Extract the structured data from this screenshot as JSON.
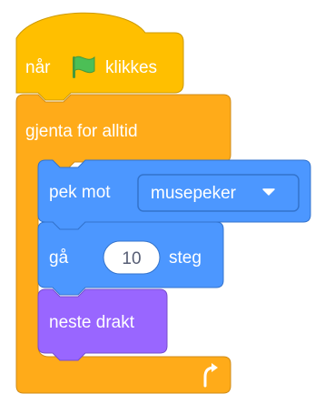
{
  "palette": {
    "events": "#ffbf00",
    "events_border": "#cc9900",
    "control": "#ffab19",
    "control_border": "#cf8b17",
    "motion": "#4c97ff",
    "motion_border": "#3373cc",
    "looks": "#9966ff",
    "looks_border": "#774dcb",
    "flag": "#4cbf56",
    "flag_dark": "#45993d"
  },
  "blocks": {
    "when_flag": {
      "prefix": "når",
      "flag_icon": "green-flag-icon",
      "suffix": "klikkes"
    },
    "forever": {
      "label": "gjenta for alltid",
      "loop_icon": "loop-arrow-icon"
    },
    "point_towards": {
      "label": "pek mot",
      "dropdown_value": "musepeker",
      "dropdown_icon": "dropdown-arrow-icon"
    },
    "move_steps": {
      "label_before": "gå",
      "value": "10",
      "label_after": "steg"
    },
    "next_costume": {
      "label": "neste drakt"
    }
  }
}
